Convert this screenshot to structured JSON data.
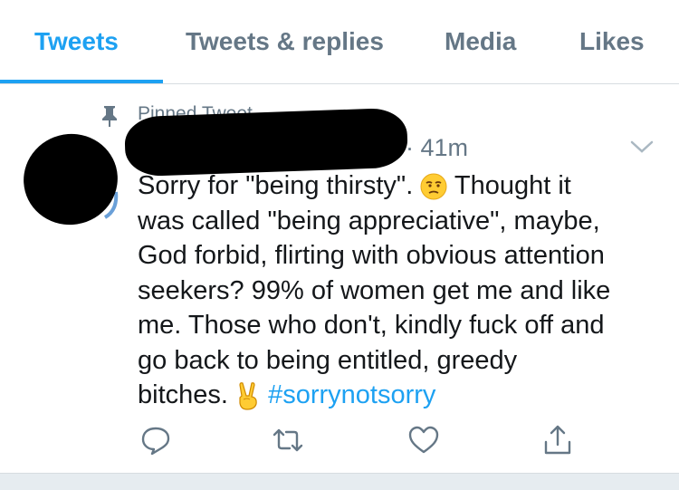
{
  "tabs": [
    {
      "label": "Tweets",
      "active": true
    },
    {
      "label": "Tweets & replies",
      "active": false
    },
    {
      "label": "Media",
      "active": false
    },
    {
      "label": "Likes",
      "active": false
    }
  ],
  "tweet": {
    "pinned_label": "Pinned Tweet",
    "time": "· 41m",
    "lines": {
      "l1a": "Sorry for \"being thirsty\".",
      "l1b": "Thought it",
      "l2": "was called \"being appreciative\", maybe,",
      "l3": "God forbid, flirting with obvious attention",
      "l4": "seekers? 99% of women get me and like",
      "l5": "me. Those who don't, kindly fuck off and",
      "l6": "go back to being entitled, greedy",
      "l7": "bitches."
    },
    "hashtag": "#sorrynotsorry",
    "emojis": [
      "unamused-face",
      "victory-hand"
    ]
  },
  "actions": [
    "reply-icon",
    "retweet-icon",
    "like-icon",
    "share-icon"
  ],
  "colors": {
    "accent": "#1da1f2",
    "muted": "#657786",
    "text": "#14171a",
    "divider": "#d7dce0"
  }
}
